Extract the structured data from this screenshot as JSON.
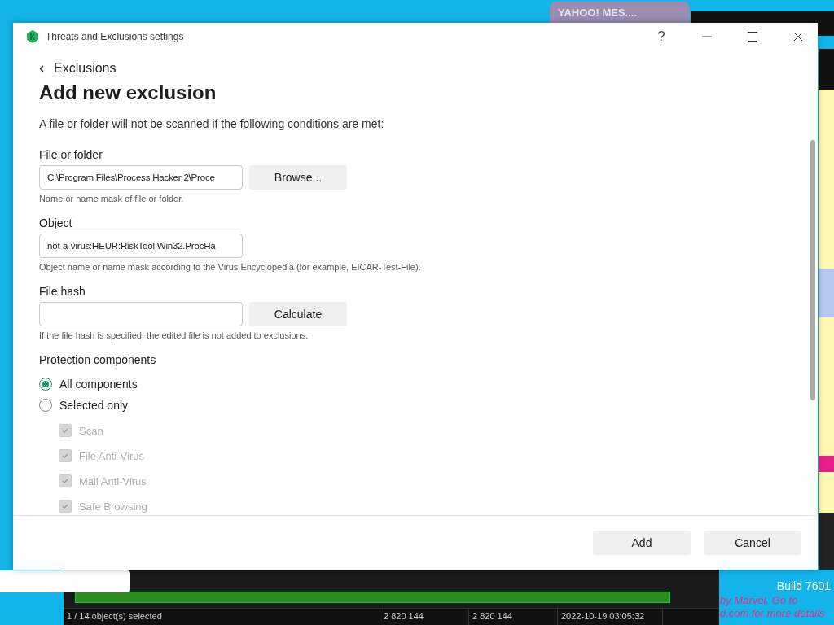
{
  "background_window": {
    "title": "YAHOO! MES...."
  },
  "desktop": {
    "texts": [
      "Build 7601",
      "by Marvel. Go to",
      "d.com for more details"
    ]
  },
  "behind_app": {
    "status_bar": [
      "1 / 14 object(s) selected",
      "2 820 144",
      "2 820 144",
      "2022-10-19 03:05:32"
    ]
  },
  "dialog": {
    "title": "Threats and Exclusions settings",
    "help": "?",
    "back_link": "Exclusions",
    "heading": "Add new exclusion",
    "intro": "A file or folder will not be scanned if the following conditions are met:",
    "fields": [
      {
        "label": "File or folder",
        "value": "C:\\Program Files\\Process Hacker 2\\Proce",
        "button": "Browse...",
        "hint": "Name or name mask of file or folder."
      },
      {
        "label": "Object",
        "value": "not-a-virus:HEUR:RiskTool.Win32.ProcHa",
        "hint": "Object name or name mask according to the Virus Encyclopedia (for example, EICAR-Test-File)."
      },
      {
        "label": "File hash",
        "button": "Calculate",
        "hint": "If the file hash is specified, the edited file is not added to exclusions."
      }
    ],
    "components": {
      "title": "Protection components",
      "options": [
        {
          "label": "All components",
          "selected": true
        },
        {
          "label": "Selected only",
          "selected": false
        }
      ],
      "items": [
        {
          "label": "Scan",
          "checked": true,
          "disabled": true
        },
        {
          "label": "File Anti-Virus",
          "checked": true,
          "disabled": true
        },
        {
          "label": "Mail Anti-Virus",
          "checked": true,
          "disabled": true
        },
        {
          "label": "Safe Browsing",
          "checked": true,
          "disabled": true
        }
      ]
    },
    "buttons": [
      "Add",
      "Cancel"
    ]
  }
}
